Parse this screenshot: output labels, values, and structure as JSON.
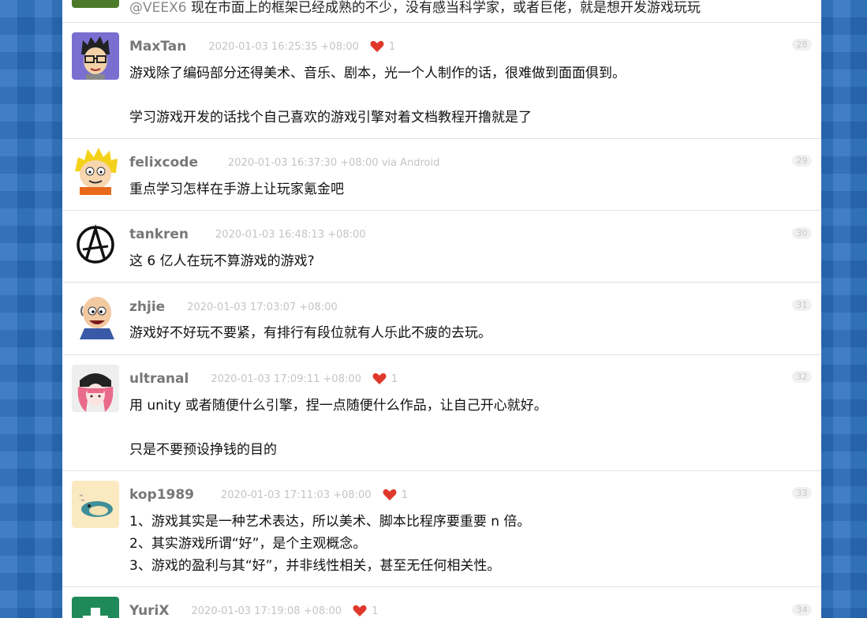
{
  "replies": [
    {
      "partial": true,
      "lines": [
        "现在市面上的框架已经成熟的不少，没有感当科学家，或者巨佬，就是想开发游戏玩玩"
      ],
      "mention": "@VEEX6"
    },
    {
      "username": "MaxTan",
      "time": "2020-01-03 16:25:35 +08:00",
      "likes": "1",
      "floor": "28",
      "avatar_icon": "avatar-glasses-cartoon",
      "lines": [
        "游戏除了编码部分还得美术、音乐、剧本，光一个人制作的话，很难做到面面俱到。",
        "",
        "学习游戏开发的话找个自己喜欢的游戏引擎对着文档教程开撸就是了"
      ]
    },
    {
      "username": "felixcode",
      "time": "2020-01-03 16:37:30 +08:00 via Android",
      "likes": null,
      "floor": "29",
      "avatar_icon": "avatar-yellow-hair-cartoon",
      "lines": [
        "重点学习怎样在手游上让玩家氪金吧"
      ]
    },
    {
      "username": "tankren",
      "time": "2020-01-03 16:48:13 +08:00",
      "likes": null,
      "floor": "30",
      "avatar_icon": "avatar-anarchy-symbol",
      "lines": [
        "这 6 亿人在玩不算游戏的游戏?"
      ]
    },
    {
      "username": "zhjie",
      "time": "2020-01-03 17:03:07 +08:00",
      "likes": null,
      "floor": "31",
      "avatar_icon": "avatar-bald-cartoon",
      "lines": [
        "游戏好不好玩不要紧，有排行有段位就有人乐此不疲的去玩。"
      ]
    },
    {
      "username": "ultranal",
      "time": "2020-01-03 17:09:11 +08:00",
      "likes": "1",
      "floor": "32",
      "avatar_icon": "avatar-anime-girl",
      "lines": [
        "用 unity 或者随便什么引擎，捏一点随便什么作品，让自己开心就好。",
        "",
        "只是不要预设挣钱的目的"
      ]
    },
    {
      "username": "kop1989",
      "time": "2020-01-03 17:11:03 +08:00",
      "likes": "1",
      "floor": "33",
      "avatar_icon": "avatar-snorlax",
      "lines": [
        "1、游戏其实是一种艺术表达，所以美术、脚本比程序要重要 n 倍。",
        "2、其实游戏所谓“好”，是个主观概念。",
        "3、游戏的盈利与其“好”，并非线性相关，甚至无任何相关性。"
      ]
    },
    {
      "username": "YuriX",
      "time": "2020-01-03 17:19:08 +08:00",
      "likes": "1",
      "floor": "34",
      "avatar_icon": "avatar-green-cross",
      "lines": []
    }
  ],
  "colors": {
    "background": "#2a6fbd",
    "heart": "#e0392b"
  }
}
